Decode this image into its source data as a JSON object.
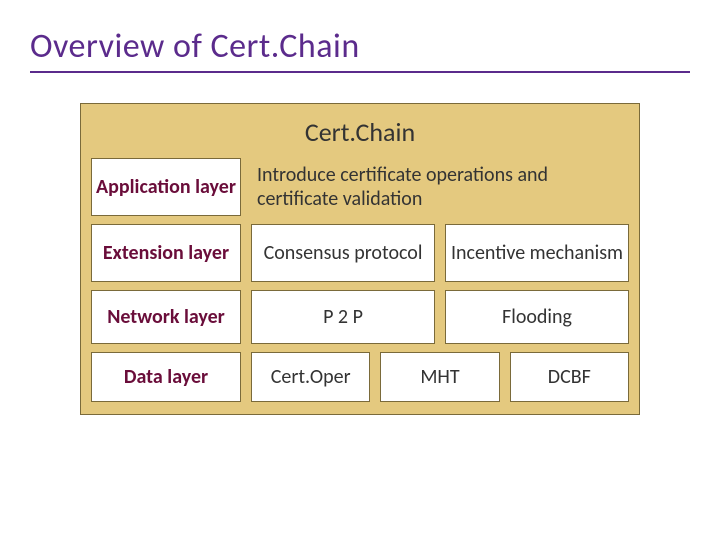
{
  "title": "Overview of Cert.Chain",
  "board": {
    "title": "Cert.Chain",
    "rows": {
      "application": {
        "layer": "Application layer",
        "desc": "Introduce certificate operations and certificate validation"
      },
      "extension": {
        "layer": "Extension layer",
        "left": "Consensus protocol",
        "right": "Incentive mechanism"
      },
      "network": {
        "layer": "Network layer",
        "left": "P 2 P",
        "right": "Flooding"
      },
      "data": {
        "layer": "Data layer",
        "c1": "Cert.Oper",
        "c2": "MHT",
        "c3": "DCBF"
      }
    }
  }
}
